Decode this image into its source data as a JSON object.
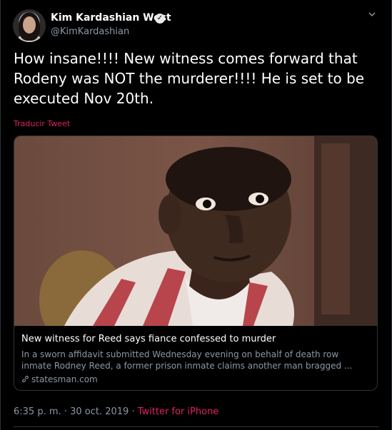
{
  "user": {
    "name": "Kim Kardashian West",
    "handle": "@KimKardashian",
    "verified_mark": "✓"
  },
  "tweet": {
    "text": "How insane!!!! New witness comes forward that Rodeny was NOT the murderer!!!! He is set to be executed Nov 20th.",
    "translate_label": "Traducir Tweet"
  },
  "card": {
    "title": "New witness for Reed says fiance confessed to murder",
    "description": "In a sworn affidavit submitted Wednesday evening on behalf of death row inmate Rodney Reed, a former prison inmate claims another man bragged ...",
    "domain": "statesman.com"
  },
  "meta": {
    "time": "6:35 p. m.",
    "separator1": "·",
    "date": "30 oct. 2019",
    "separator2": "·",
    "source": "Twitter for iPhone"
  },
  "colors": {
    "background": "#000000",
    "text": "#ffffff",
    "secondary": "#8b98a5",
    "accent": "#e0245e",
    "border": "#2f3336"
  },
  "icons": {
    "caret": "chevron-down-icon",
    "link": "link-icon",
    "verified": "verified-badge-icon"
  }
}
